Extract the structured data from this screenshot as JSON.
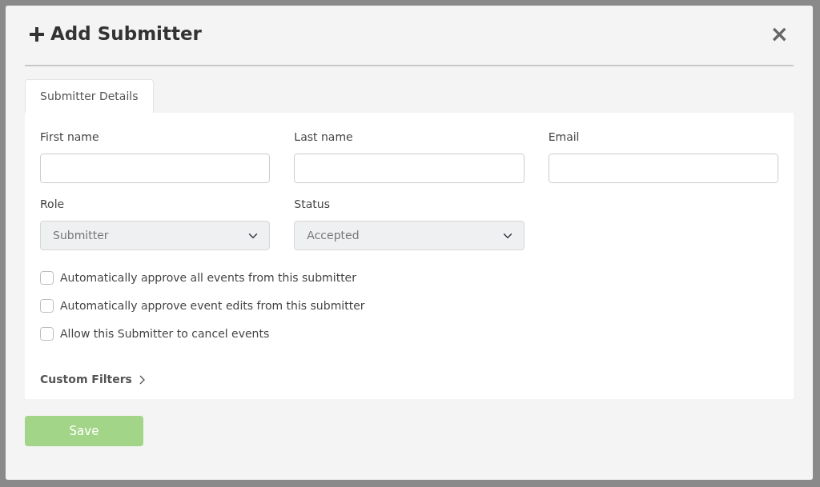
{
  "modal": {
    "title": "Add Submitter",
    "close": "×"
  },
  "tabs": [
    {
      "label": "Submitter Details",
      "selected": true
    }
  ],
  "text_fields": [
    {
      "label": "First name"
    },
    {
      "label": "Last name"
    },
    {
      "label": "Email"
    }
  ],
  "select_fields": [
    {
      "label": "Role",
      "value": "Submitter",
      "disabled": true
    },
    {
      "label": "Status",
      "value": "Accepted",
      "disabled": true
    }
  ],
  "checkboxes": [
    {
      "label": "Automatically approve all events from this submitter",
      "checked": false
    },
    {
      "label": "Automatically approve event edits from this submitter",
      "checked": false
    },
    {
      "label": "Allow this Submitter to cancel events",
      "checked": false
    }
  ],
  "custom_filters": {
    "label": "Custom Filters",
    "expanded": false
  },
  "save_button": {
    "label": "Save",
    "disabled": true
  }
}
